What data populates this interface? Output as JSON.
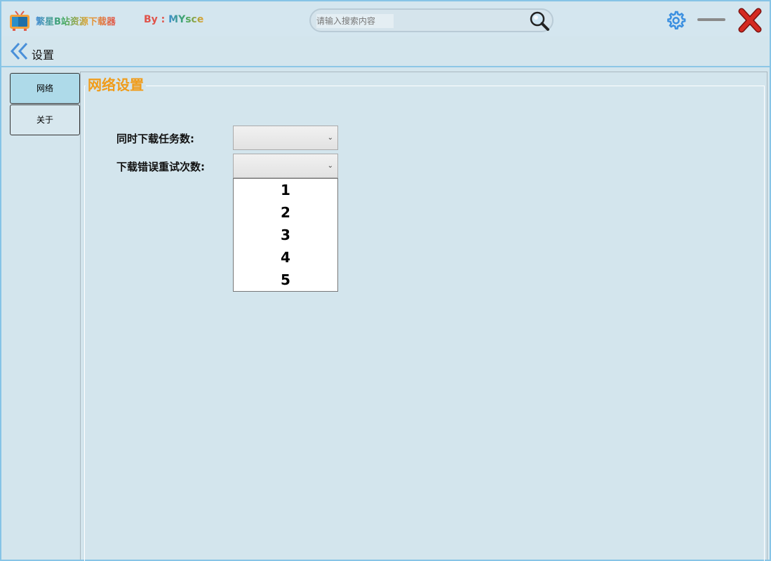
{
  "app": {
    "title": "繁星B站资源下载器",
    "author_prefix": "By : ",
    "author_name": "MYsce"
  },
  "search": {
    "placeholder": "请输入搜索内容",
    "value": ""
  },
  "header": {
    "title": "设置"
  },
  "sidebar": {
    "items": [
      {
        "label": "网络",
        "active": true
      },
      {
        "label": "关于",
        "active": false
      }
    ]
  },
  "network_settings": {
    "group_title": "网络设置",
    "concurrent_label": "同时下载任务数:",
    "concurrent_value": "",
    "retry_label": "下载错误重试次数:",
    "retry_value": "",
    "retry_options": [
      "1",
      "2",
      "3",
      "4",
      "5"
    ]
  },
  "icons": {
    "logo": "tv-icon",
    "search": "magnifier-icon",
    "settings": "gear-icon",
    "minimize": "minimize-icon",
    "close": "close-icon",
    "back": "double-chevron-left-icon",
    "dropdown_arrow": "chevron-down-icon"
  },
  "colors": {
    "accent_orange": "#f09c1a",
    "close_red": "#c0201c",
    "gear_blue": "#3a8fe0",
    "window_bg": "#d3e5ed"
  }
}
